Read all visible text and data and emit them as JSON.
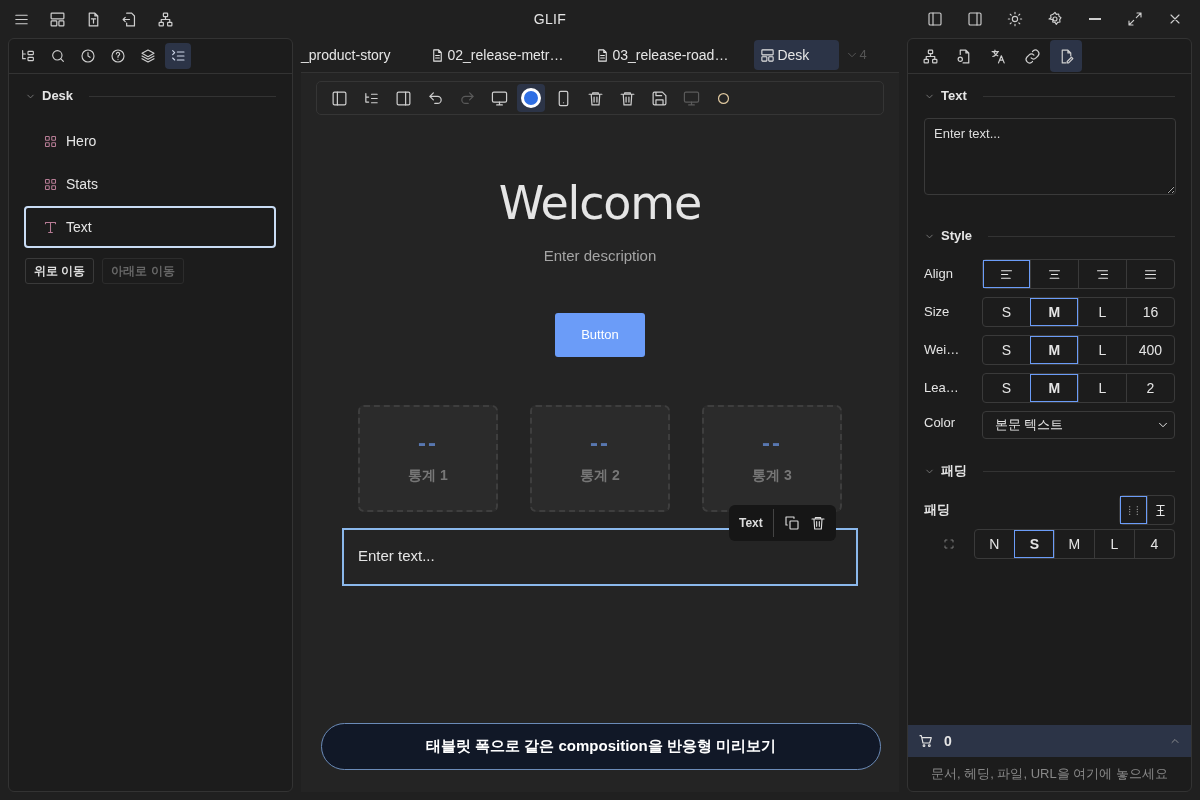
{
  "title_bar": {
    "title": "GLIF"
  },
  "left_panel": {
    "tabs": [
      {
        "selected": false
      },
      {
        "selected": false
      },
      {
        "selected": false
      },
      {
        "selected": false
      },
      {
        "selected": false
      },
      {
        "selected": true
      }
    ],
    "section": {
      "title": "Desk",
      "expanded": true
    },
    "items": [
      {
        "label": "Hero",
        "kind": "block",
        "selected": false
      },
      {
        "label": "Stats",
        "kind": "block",
        "selected": false
      },
      {
        "label": "Text",
        "kind": "text",
        "selected": true
      }
    ],
    "buttons": [
      {
        "label": "위로 이동",
        "disabled": false
      },
      {
        "label": "아래로 이동",
        "disabled": true
      }
    ]
  },
  "editor_tabs": [
    {
      "label": "_product-story",
      "kind": "plain",
      "selected": false
    },
    {
      "label": "02_release-metr…",
      "kind": "doc",
      "selected": false
    },
    {
      "label": "03_release-road…",
      "kind": "doc",
      "selected": false
    },
    {
      "label": "Desk",
      "kind": "layout",
      "selected": true
    }
  ],
  "tab_overflow": "4",
  "toolbar": [
    {
      "disabled": false,
      "selected": false
    },
    {
      "disabled": false,
      "selected": false
    },
    {
      "disabled": false,
      "selected": false
    },
    {
      "disabled": false,
      "selected": false
    },
    {
      "disabled": true,
      "selected": false
    },
    {
      "disabled": false,
      "selected": false
    },
    {
      "disabled": false,
      "selected": true
    },
    {
      "disabled": false,
      "selected": false
    },
    {
      "disabled": false,
      "selected": false
    },
    {
      "disabled": false,
      "selected": false
    },
    {
      "disabled": false,
      "selected": false
    },
    {
      "disabled": true,
      "selected": false
    },
    {
      "disabled": false,
      "selected": false
    }
  ],
  "canvas": {
    "heading": "Welcome",
    "description": "Enter description",
    "button": "Button",
    "stats": [
      {
        "value": "--",
        "label": "통계 1"
      },
      {
        "value": "--",
        "label": "통계 2"
      },
      {
        "value": "--",
        "label": "통계 3"
      }
    ],
    "block_toolbar": {
      "label": "Text"
    },
    "text_block": {
      "text": "Enter text...",
      "selected": true
    }
  },
  "preview_button": "태블릿 폭으로 같은 composition을 반응형 미리보기",
  "right_panel": {
    "tabs": [
      {
        "selected": false
      },
      {
        "selected": false
      },
      {
        "selected": false
      },
      {
        "selected": false
      },
      {
        "selected": true
      }
    ],
    "text_section": {
      "title": "Text",
      "expanded": true,
      "placeholder": "Enter text..."
    },
    "style_section": {
      "title": "Style",
      "expanded": true,
      "align": {
        "label": "Align",
        "options": [
          {
            "selected": true
          },
          {
            "selected": false
          },
          {
            "selected": false
          },
          {
            "selected": false
          }
        ]
      },
      "rows": [
        {
          "label": "Size",
          "options": [
            {
              "label": "S",
              "selected": false
            },
            {
              "label": "M",
              "selected": true
            },
            {
              "label": "L",
              "selected": false
            },
            {
              "label": "16",
              "selected": false
            }
          ]
        },
        {
          "label": "Wei…",
          "options": [
            {
              "label": "S",
              "selected": false
            },
            {
              "label": "M",
              "selected": true
            },
            {
              "label": "L",
              "selected": false
            },
            {
              "label": "400",
              "selected": false
            }
          ]
        },
        {
          "label": "Lea…",
          "options": [
            {
              "label": "S",
              "selected": false
            },
            {
              "label": "M",
              "selected": true
            },
            {
              "label": "L",
              "selected": false
            },
            {
              "label": "2",
              "selected": false
            }
          ]
        }
      ],
      "color": {
        "label": "Color",
        "value": "본문 텍스트"
      }
    },
    "padding_section": {
      "title": "패딩",
      "expanded": true,
      "label": "패딩",
      "modes": [
        {
          "selected": true
        },
        {
          "selected": false
        }
      ],
      "options": [
        {
          "label": "N",
          "selected": false
        },
        {
          "label": "S",
          "selected": true
        },
        {
          "label": "M",
          "selected": false
        },
        {
          "label": "L",
          "selected": false
        },
        {
          "label": "4",
          "selected": false
        }
      ]
    },
    "cart": {
      "count": "0",
      "expanded": false,
      "hint": "문서, 헤딩, 파일, URL을 여기에 놓으세요"
    }
  }
}
